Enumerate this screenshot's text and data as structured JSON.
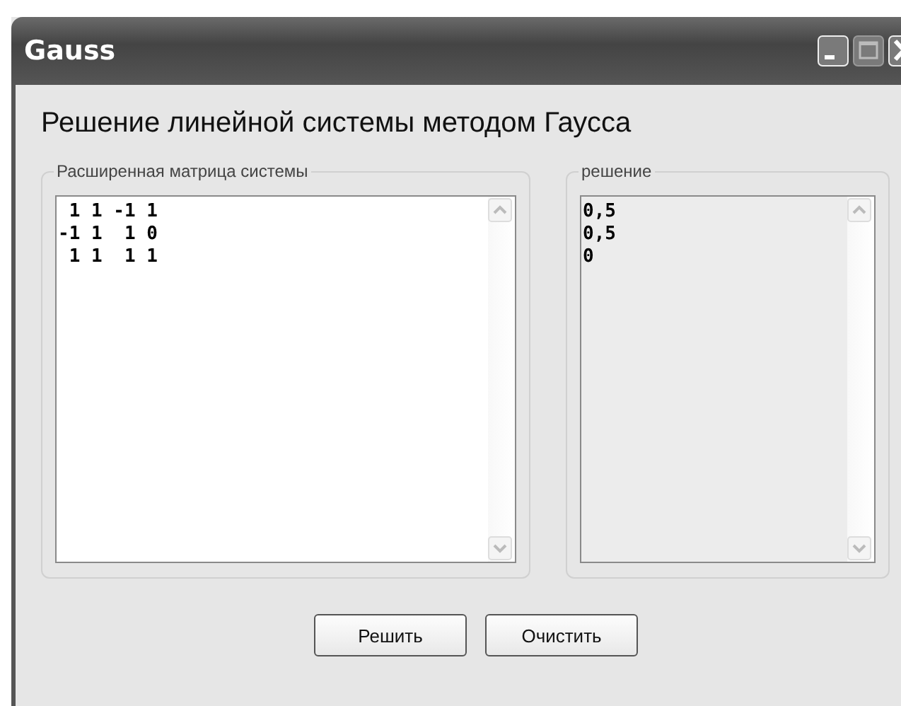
{
  "window": {
    "title": "Gauss"
  },
  "heading": "Решение линейной системы методом Гаусса",
  "matrix_group": {
    "label": "Расширенная матрица системы",
    "lines": [
      " 1 1 -1 1",
      "-1 1  1 0",
      " 1 1  1 1"
    ],
    "readonly": false
  },
  "solution_group": {
    "label": "решение",
    "lines": [
      "0,5",
      "0,5",
      "0"
    ],
    "readonly": true
  },
  "buttons": [
    {
      "label": "Решить"
    },
    {
      "label": "Очистить"
    }
  ]
}
